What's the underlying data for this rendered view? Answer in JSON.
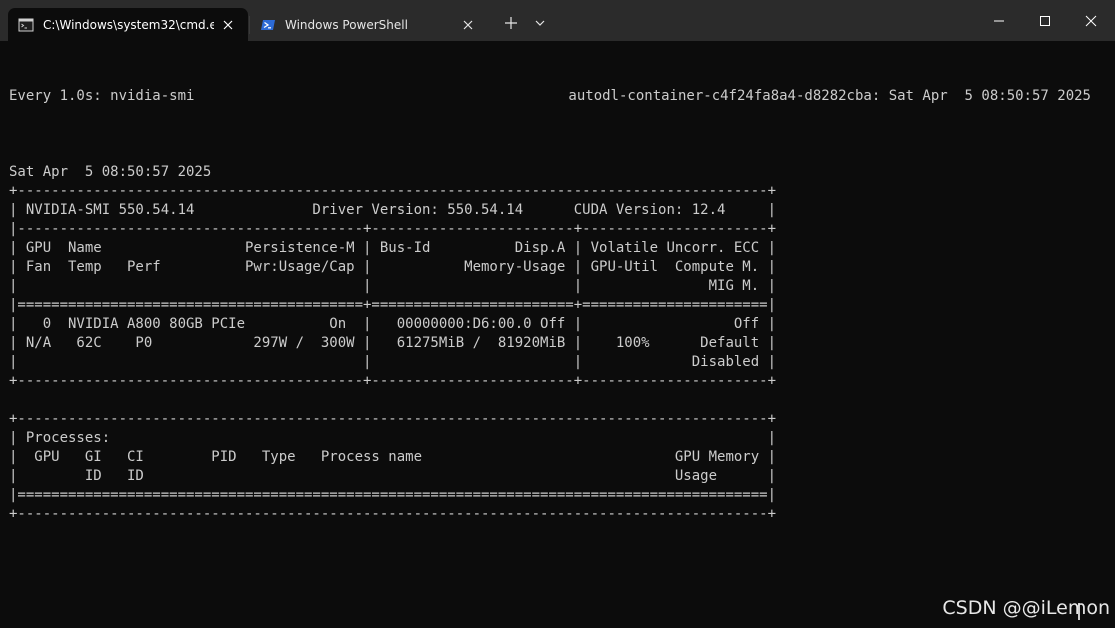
{
  "tabs": [
    {
      "label": "C:\\Windows\\system32\\cmd.e:",
      "active": true,
      "icon": "cmd-icon"
    },
    {
      "label": "Windows PowerShell",
      "active": false,
      "icon": "powershell-icon"
    }
  ],
  "titlebar_icons": {
    "new_tab": "plus-icon",
    "dropdown": "chevron-down-icon",
    "minimize": "minimize-icon",
    "maximize": "maximize-icon",
    "close": "close-icon"
  },
  "colors": {
    "terminal_bg": "#0c0c0c",
    "terminal_fg": "#cccccc",
    "titlebar_bg": "#2b2b2b"
  },
  "terminal": {
    "watch_header": "Every 1.0s: nvidia-smi",
    "host_timestamp": "autodl-container-c4f24fa8a4-d8282cba: Sat Apr  5 08:50:57 2025",
    "lines": [
      "",
      "Sat Apr  5 08:50:57 2025",
      "+-----------------------------------------------------------------------------------------+",
      "| NVIDIA-SMI 550.54.14              Driver Version: 550.54.14      CUDA Version: 12.4     |",
      "|-----------------------------------------+------------------------+----------------------+",
      "| GPU  Name                 Persistence-M | Bus-Id          Disp.A | Volatile Uncorr. ECC |",
      "| Fan  Temp   Perf          Pwr:Usage/Cap |           Memory-Usage | GPU-Util  Compute M. |",
      "|                                         |                        |               MIG M. |",
      "|=========================================+========================+======================|",
      "|   0  NVIDIA A800 80GB PCIe          On  |   00000000:D6:00.0 Off |                  Off |",
      "| N/A   62C    P0            297W /  300W |   61275MiB /  81920MiB |    100%      Default |",
      "|                                         |                        |             Disabled |",
      "+-----------------------------------------+------------------------+----------------------+",
      "",
      "+-----------------------------------------------------------------------------------------+",
      "| Processes:                                                                              |",
      "|  GPU   GI   CI        PID   Type   Process name                              GPU Memory |",
      "|        ID   ID                                                               Usage      |",
      "|=========================================================================================|",
      "+-----------------------------------------------------------------------------------------+"
    ]
  },
  "watermark": "CSDN @@iLemon"
}
